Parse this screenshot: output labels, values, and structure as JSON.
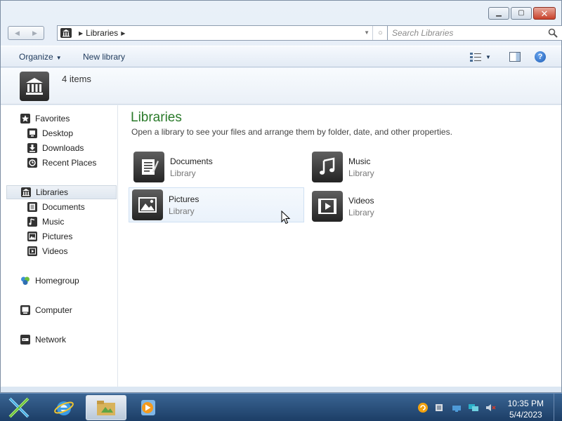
{
  "address": {
    "crumbs": [
      "Libraries"
    ]
  },
  "search": {
    "placeholder": "Search Libraries"
  },
  "commands": {
    "organize": "Organize",
    "new_library": "New library"
  },
  "details": {
    "count": "4 items"
  },
  "nav": {
    "favorites": "Favorites",
    "favorites_items": [
      "Desktop",
      "Downloads",
      "Recent Places"
    ],
    "libraries": "Libraries",
    "libraries_items": [
      "Documents",
      "Music",
      "Pictures",
      "Videos"
    ],
    "homegroup": "Homegroup",
    "computer": "Computer",
    "network": "Network"
  },
  "content": {
    "title": "Libraries",
    "description": "Open a library to see your files and arrange them by folder, date, and other properties.",
    "tiles": [
      {
        "name": "Documents",
        "type": "Library",
        "icon": "documents-library-icon"
      },
      {
        "name": "Music",
        "type": "Library",
        "icon": "music-library-icon"
      },
      {
        "name": "Pictures",
        "type": "Library",
        "icon": "pictures-library-icon"
      },
      {
        "name": "Videos",
        "type": "Library",
        "icon": "videos-library-icon"
      }
    ]
  },
  "taskbar": {
    "time": "10:35 PM",
    "date": "5/4/2023"
  },
  "colors": {
    "title_green": "#2a7a2a",
    "taskbar": "#2a5080",
    "close_red": "#c8412a"
  }
}
